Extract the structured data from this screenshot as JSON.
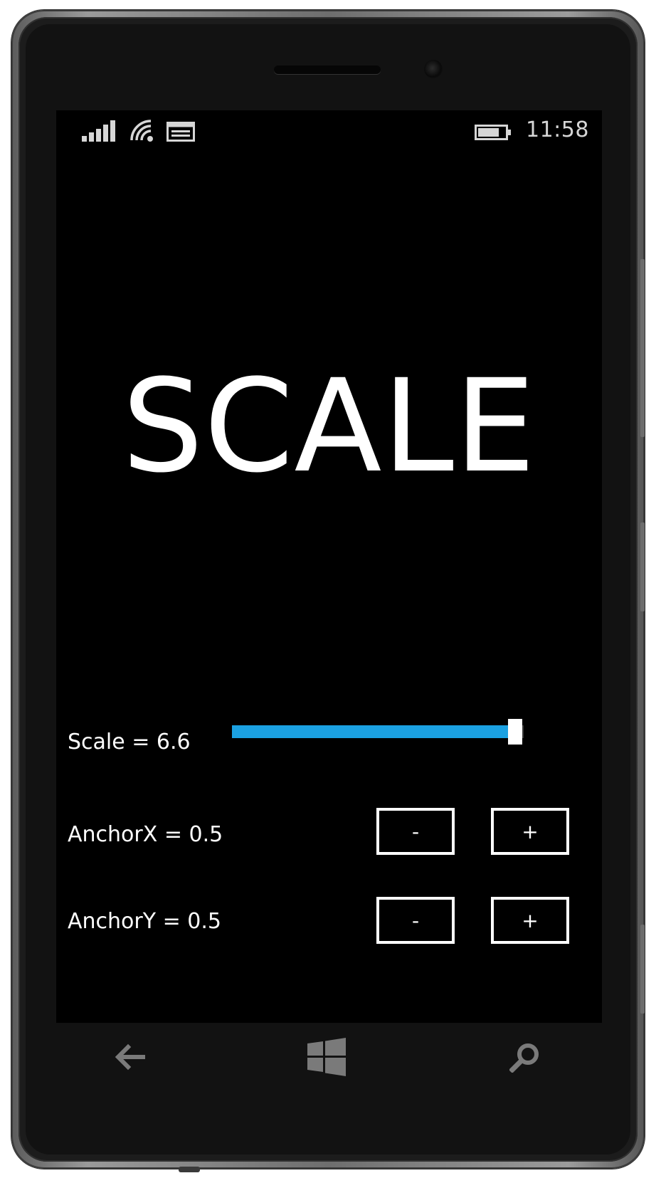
{
  "status_bar": {
    "time": "11:58",
    "icons": [
      "signal-bars-icon",
      "wifi-icon",
      "message-icon",
      "battery-icon"
    ]
  },
  "demo": {
    "label_text": "SCALE"
  },
  "controls": {
    "scale_readout": "Scale = 6.6",
    "scale_slider_fraction": 0.97,
    "anchor_x_readout": "AnchorX = 0.5",
    "anchor_y_readout": "AnchorY = 0.5",
    "minus_label": "-",
    "plus_label": "+"
  },
  "nav_bar": {
    "icons": [
      "back-arrow-icon",
      "windows-start-icon",
      "search-icon"
    ]
  },
  "colors": {
    "accent": "#1ba1e2",
    "background": "#000000",
    "foreground": "#ffffff"
  }
}
